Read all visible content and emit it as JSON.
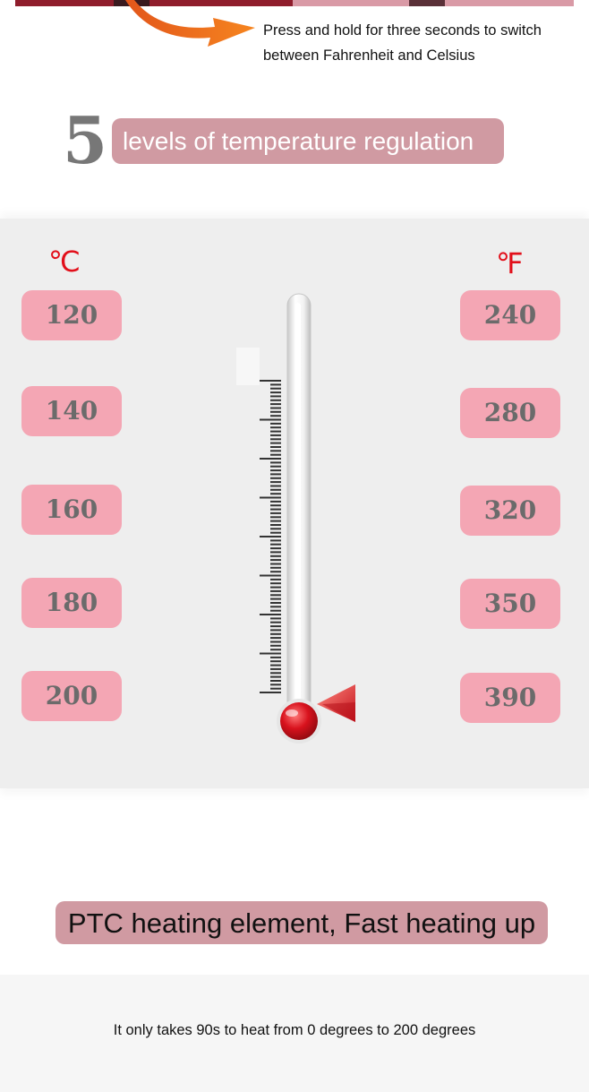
{
  "header": {
    "instruction": "Press and hold for three seconds to switch between Fahrenheit and Celsius"
  },
  "levels": {
    "number": "5",
    "label": "levels of temperature regulation"
  },
  "thermometer_panel": {
    "celsius_unit": "℃",
    "fahrenheit_unit": "℉",
    "celsius_values": [
      "120",
      "140",
      "160",
      "180",
      "200"
    ],
    "fahrenheit_values": [
      "240",
      "280",
      "320",
      "350",
      "390"
    ]
  },
  "feature": {
    "heading": "PTC heating element, Fast heating up",
    "description": "It only takes 90s to heat from 0 degrees to 200 degrees"
  },
  "colors": {
    "pill_pink": "#f4a6b4",
    "heading_pill": "#d09aa2",
    "unit_red": "#e20f1a",
    "bulb_red": "#d8121d"
  }
}
